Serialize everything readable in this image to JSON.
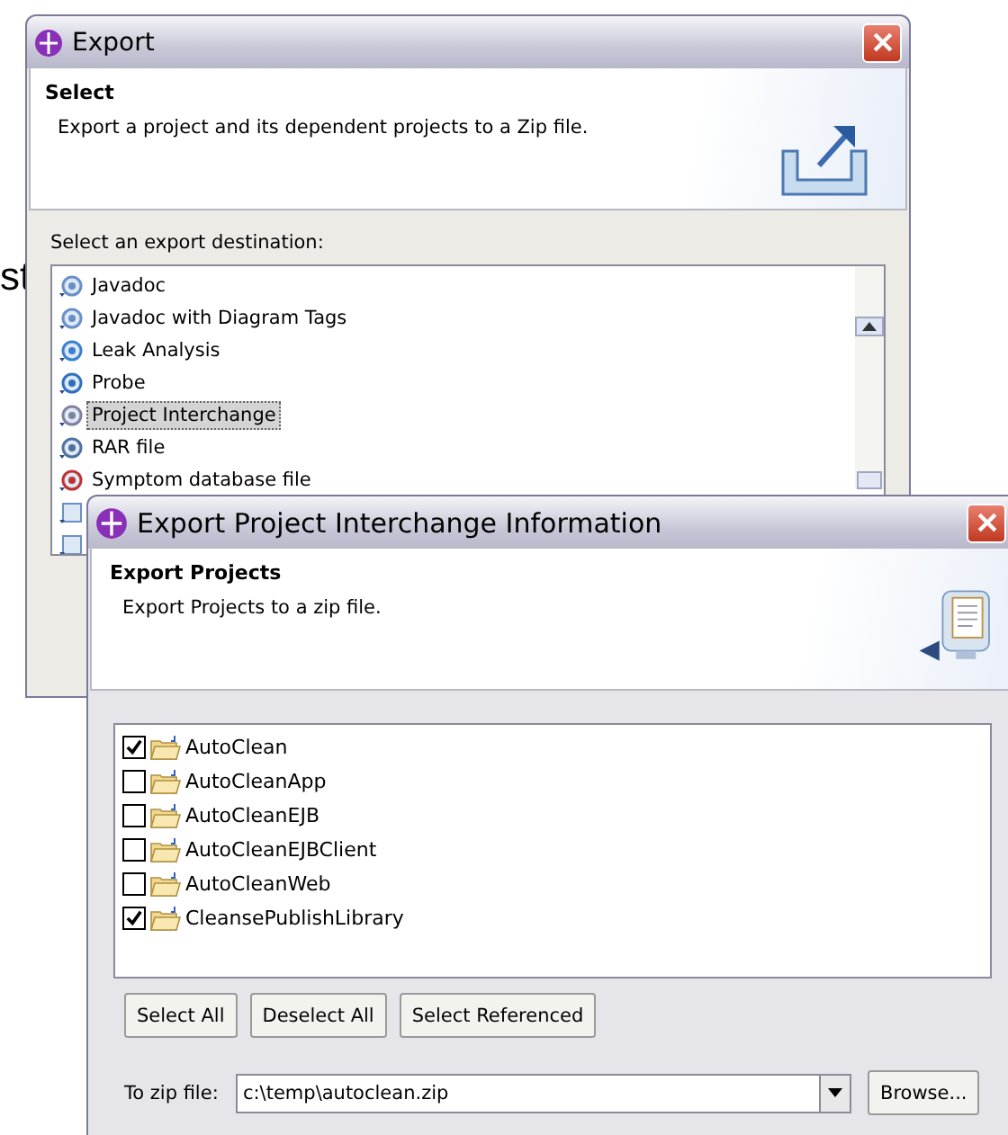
{
  "background_fragment": "st",
  "export_window": {
    "title": "Export",
    "header_title": "Select",
    "header_description": "Export a project and its dependent projects to a Zip file.",
    "list_label": "Select an export destination:",
    "destinations": [
      {
        "label": "Javadoc",
        "selected": false
      },
      {
        "label": "Javadoc with Diagram Tags",
        "selected": false
      },
      {
        "label": "Leak Analysis",
        "selected": false
      },
      {
        "label": "Probe",
        "selected": false
      },
      {
        "label": "Project Interchange",
        "selected": true
      },
      {
        "label": "RAR file",
        "selected": false
      },
      {
        "label": "Symptom database file",
        "selected": false
      }
    ]
  },
  "interchange_window": {
    "title": "Export Project Interchange Information",
    "header_title": "Export Projects",
    "header_description": "Export Projects to a zip file.",
    "projects": [
      {
        "name": "AutoClean",
        "checked": true
      },
      {
        "name": "AutoCleanApp",
        "checked": false
      },
      {
        "name": "AutoCleanEJB",
        "checked": false
      },
      {
        "name": "AutoCleanEJBClient",
        "checked": false
      },
      {
        "name": "AutoCleanWeb",
        "checked": false
      },
      {
        "name": "CleansePublishLibrary",
        "checked": true
      }
    ],
    "buttons": [
      "Select All",
      "Deselect All",
      "Select Referenced"
    ],
    "zip_label": "To zip file:",
    "zip_value": "c:\\temp\\autoclean.zip",
    "browse": "Browse..."
  }
}
